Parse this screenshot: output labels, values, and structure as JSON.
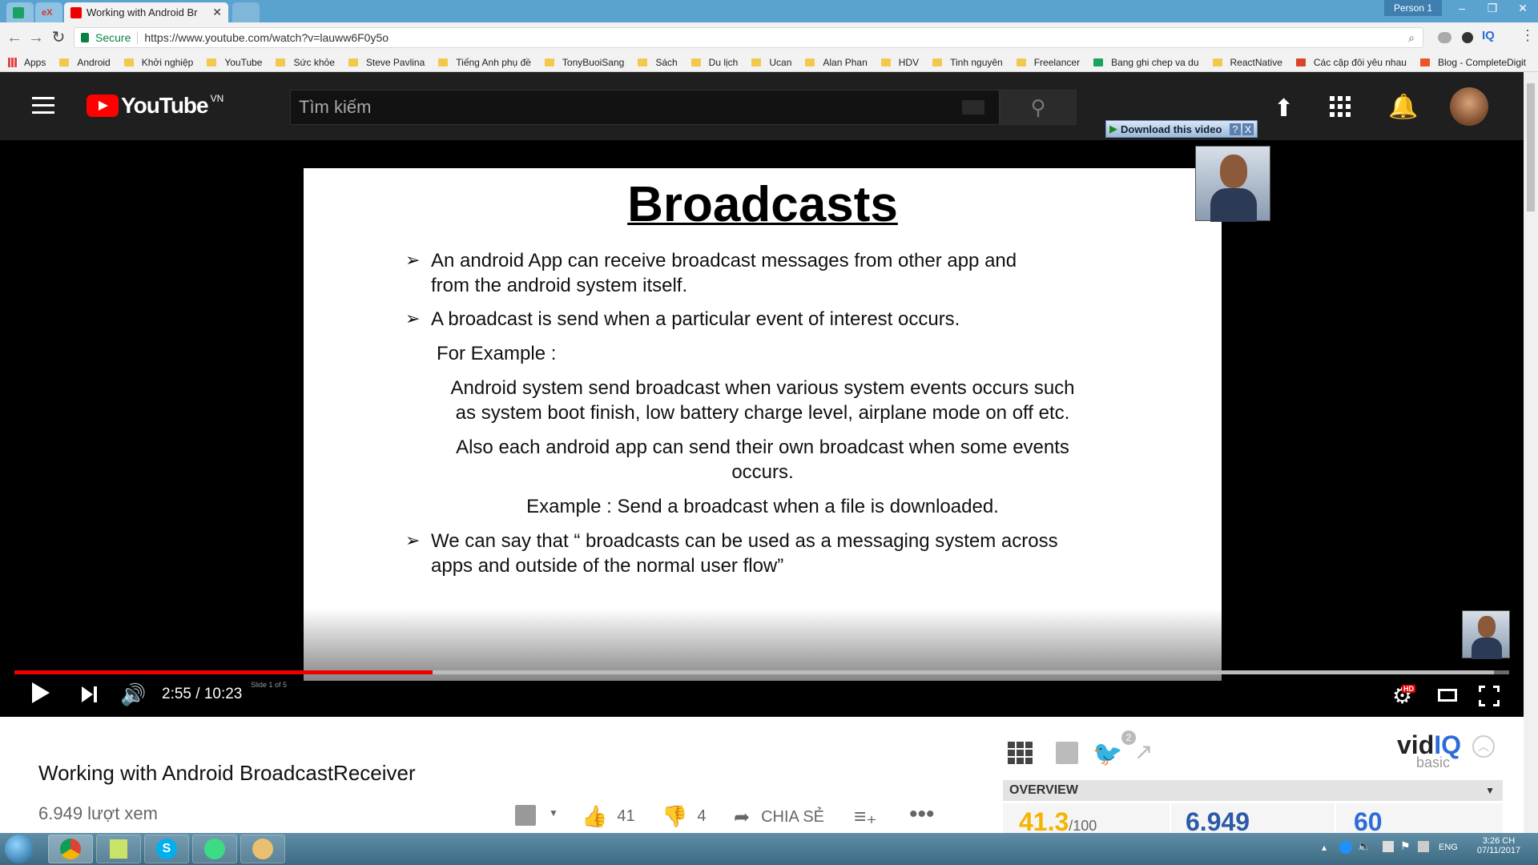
{
  "browser": {
    "tabs": [
      {
        "label": ""
      },
      {
        "label": "eX"
      },
      {
        "label": "Working with Android Br",
        "active": true
      },
      {
        "label": ""
      }
    ],
    "person": "Person 1",
    "address": {
      "secure_label": "Secure",
      "url": "https://www.youtube.com/watch?v=lauww6F0y5o"
    },
    "bookmarks": [
      "Apps",
      "Android",
      "Khởi nghiệp",
      "YouTube",
      "Sức khỏe",
      "Steve Pavlina",
      "Tiếng Anh phụ đề",
      "TonyBuoiSang",
      "Sách",
      "Du lịch",
      "Ucan",
      "Alan Phan",
      "HDV",
      "Tinh nguyên",
      "Freelancer",
      "Bang ghi chep va du",
      "ReactNative",
      "Các cặp đôi yêu nhau",
      "Blog - CompleteDigit"
    ],
    "extension_iq": "IQ"
  },
  "youtube": {
    "logo": "YouTube",
    "region": "VN",
    "search_placeholder": "Tìm kiếm",
    "download_label": "Download this video",
    "download_help": "?",
    "download_close": "X"
  },
  "slide": {
    "title": "Broadcasts",
    "lines": [
      "An android App can receive broadcast messages from other app and",
      "from the android system itself.",
      "A broadcast is send when a particular event of interest occurs.",
      "For Example :",
      "Android system send  broadcast when various system events occurs such",
      "as system boot finish, low battery charge level, airplane mode on off etc.",
      "Also each android app can send their own broadcast when some events",
      "occurs.",
      "Example : Send a broadcast when a file is downloaded.",
      "We can say that “ broadcasts can be used as a messaging system across",
      "apps and outside of the normal user flow”"
    ],
    "footer": "Slide 1 of 5"
  },
  "player": {
    "time": "2:55 / 10:23",
    "played_fraction": 0.28,
    "buffered_fraction": 0.99,
    "hd_badge": "HD"
  },
  "video": {
    "title": "Working with Android BroadcastReceiver",
    "views": "6.949 lượt xem",
    "likes": "41",
    "dislikes": "4",
    "share": "CHIA SẺ"
  },
  "vidiq": {
    "logo_vid": "vid",
    "logo_iq": "IQ",
    "logo_tier": "basic",
    "twitter_count": "2",
    "overview_label": "OVERVIEW",
    "score": "41.3",
    "score_max": "/100",
    "views": "6.949",
    "third": "60"
  },
  "taskbar": {
    "time": "3:26 CH",
    "date": "07/11/2017",
    "lang": "ENG"
  },
  "colors": {
    "youtube_red": "#ff0000",
    "vidiq_blue": "#2d6bd8",
    "score_yellow": "#f5b400"
  }
}
